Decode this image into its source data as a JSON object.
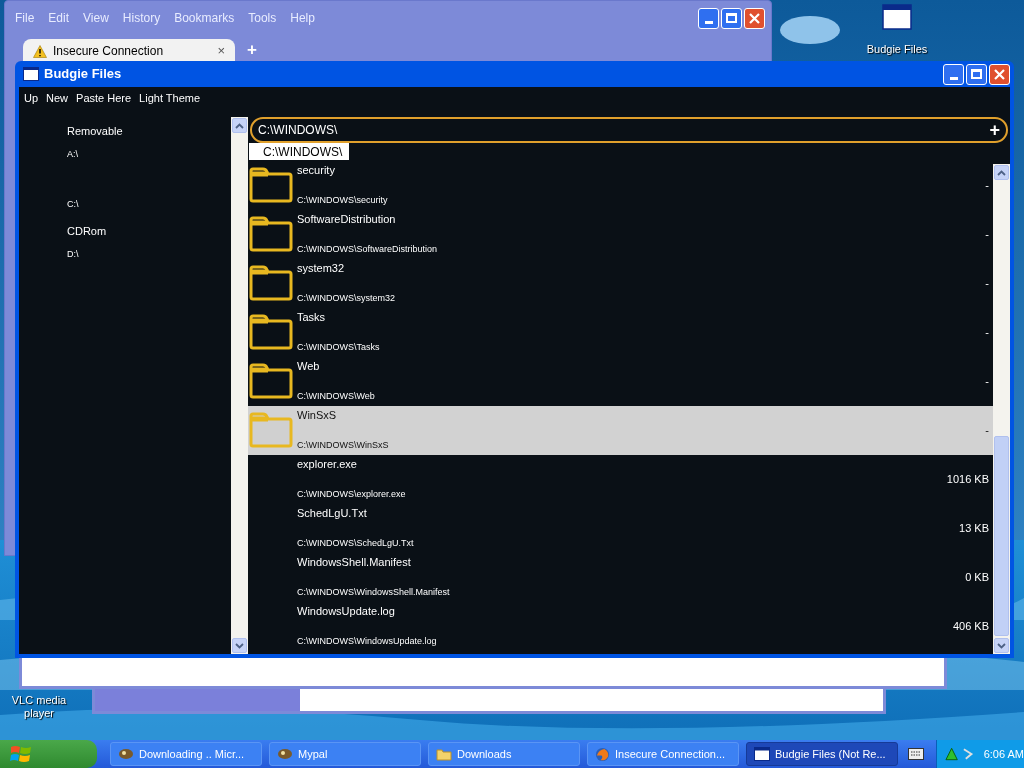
{
  "desktop": {
    "icons": [
      {
        "kind": "window",
        "label": "Budgie Files"
      },
      {
        "kind": "none",
        "label": "VLC media player"
      }
    ]
  },
  "browser_window": {
    "menu": [
      "File",
      "Edit",
      "View",
      "History",
      "Bookmarks",
      "Tools",
      "Help"
    ],
    "tab": {
      "title": "Insecure Connection",
      "close": "×"
    },
    "new_tab": "+"
  },
  "download_window": {
    "progress": {
      "level": 0.26
    }
  },
  "budgie_window": {
    "title": "Budgie Files",
    "toolbar": [
      "Up",
      "New",
      "Paste Here",
      "Light Theme"
    ],
    "sidebar": {
      "sections": [
        {
          "heading": "Removable",
          "drives": [
            "A:\\"
          ]
        },
        {
          "drives": [
            "C:\\"
          ]
        },
        {
          "heading": "CDRom",
          "drives": [
            "D:\\"
          ]
        }
      ]
    },
    "address": {
      "value": "C:\\WINDOWS\\",
      "add": "+",
      "suggestions": [
        "C:\\WINDOWS\\"
      ]
    },
    "files": [
      {
        "kind": "folder",
        "name": "security",
        "path": "C:\\WINDOWS\\security",
        "size": "-",
        "selected": false
      },
      {
        "kind": "folder",
        "name": "SoftwareDistribution",
        "path": "C:\\WINDOWS\\SoftwareDistribution",
        "size": "-",
        "selected": false
      },
      {
        "kind": "folder",
        "name": "system32",
        "path": "C:\\WINDOWS\\system32",
        "size": "-",
        "selected": false
      },
      {
        "kind": "folder",
        "name": "Tasks",
        "path": "C:\\WINDOWS\\Tasks",
        "size": "-",
        "selected": false
      },
      {
        "kind": "folder",
        "name": "Web",
        "path": "C:\\WINDOWS\\Web",
        "size": "-",
        "selected": false
      },
      {
        "kind": "folder",
        "name": "WinSxS",
        "path": "C:\\WINDOWS\\WinSxS",
        "size": "-",
        "selected": true
      },
      {
        "kind": "file",
        "name": "explorer.exe",
        "path": "C:\\WINDOWS\\explorer.exe",
        "size": "1016 KB",
        "selected": false
      },
      {
        "kind": "file",
        "name": "SchedLgU.Txt",
        "path": "C:\\WINDOWS\\SchedLgU.Txt",
        "size": "13 KB",
        "selected": false
      },
      {
        "kind": "file",
        "name": "WindowsShell.Manifest",
        "path": "C:\\WINDOWS\\WindowsShell.Manifest",
        "size": "0 KB",
        "selected": false
      },
      {
        "kind": "file",
        "name": "WindowsUpdate.log",
        "path": "C:\\WINDOWS\\WindowsUpdate.log",
        "size": "406 KB",
        "selected": false
      }
    ]
  },
  "taskbar": {
    "tasks": [
      {
        "kind": "app",
        "label": "Downloading .. Micr...",
        "selected": false
      },
      {
        "kind": "app",
        "label": "Mypal",
        "selected": false
      },
      {
        "kind": "folder",
        "label": "Downloads",
        "selected": false
      },
      {
        "kind": "browser",
        "label": "Insecure Connection...",
        "selected": false
      },
      {
        "kind": "window",
        "label": "Budgie Files (Not Re...",
        "selected": true
      }
    ],
    "clock": "6:06 AM"
  }
}
